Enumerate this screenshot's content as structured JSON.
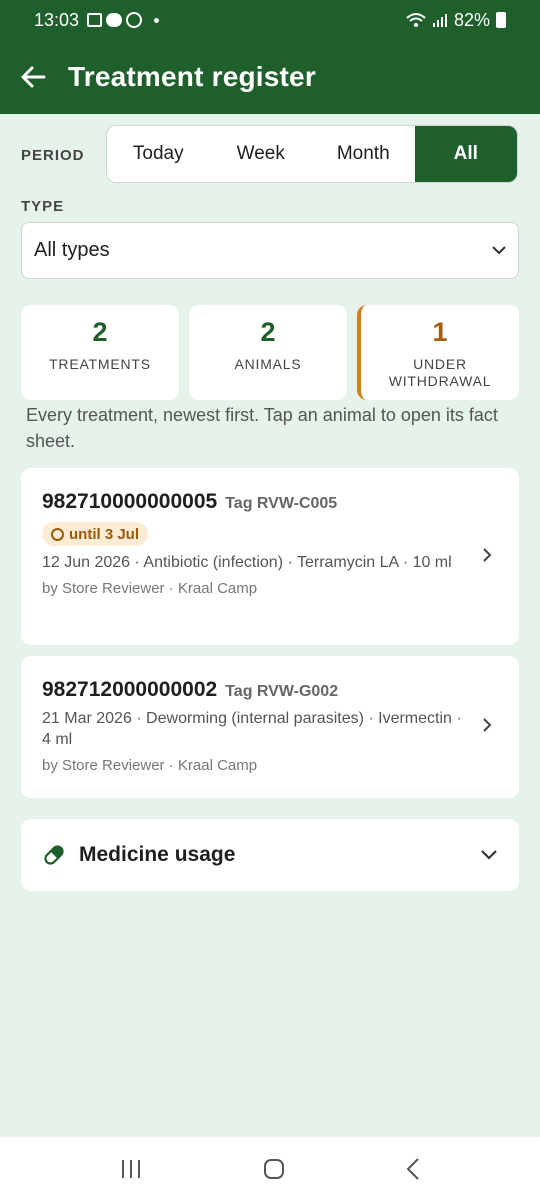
{
  "status_bar": {
    "time": "13:03",
    "battery": "82%",
    "icons": [
      "gallery-icon",
      "message-icon",
      "whatsapp-icon",
      "dot-icon",
      "wifi-icon",
      "signal-icon",
      "battery-icon"
    ]
  },
  "app_bar": {
    "title": "Treatment register",
    "back_icon": "arrow-left-icon"
  },
  "period": {
    "label": "PERIOD",
    "options": [
      "Today",
      "Week",
      "Month",
      "All"
    ],
    "selected": "All"
  },
  "type": {
    "label": "TYPE",
    "value": "All types"
  },
  "stats": [
    {
      "value": "2",
      "label": "TREATMENTS"
    },
    {
      "value": "2",
      "label": "ANIMALS"
    },
    {
      "value": "1",
      "label": "UNDER WITHDRAWAL"
    }
  ],
  "hint": "Every treatment, newest first. Tap an animal to open its fact sheet.",
  "treatments": [
    {
      "eid": "982710000000005",
      "tag": "Tag RVW-C005",
      "withdrawal": "until 3 Jul",
      "detail": "12 Jun 2026 · Antibiotic (infection) · Terramycin LA · 10 ml",
      "meta": "by Store Reviewer · Kraal Camp"
    },
    {
      "eid": "982712000000002",
      "tag": "Tag RVW-G002",
      "detail": "21 Mar 2026 · Deworming (internal parasites) · Ivermectin · 4 ml",
      "meta": "by Store Reviewer · Kraal Camp"
    }
  ],
  "medicine_usage": {
    "title": "Medicine usage",
    "icon": "pill-icon"
  },
  "colors": {
    "primary": "#1f5f2c",
    "background": "#e6f3ea",
    "warning": "#d27d1e",
    "badge_bg": "#fcecd6"
  }
}
